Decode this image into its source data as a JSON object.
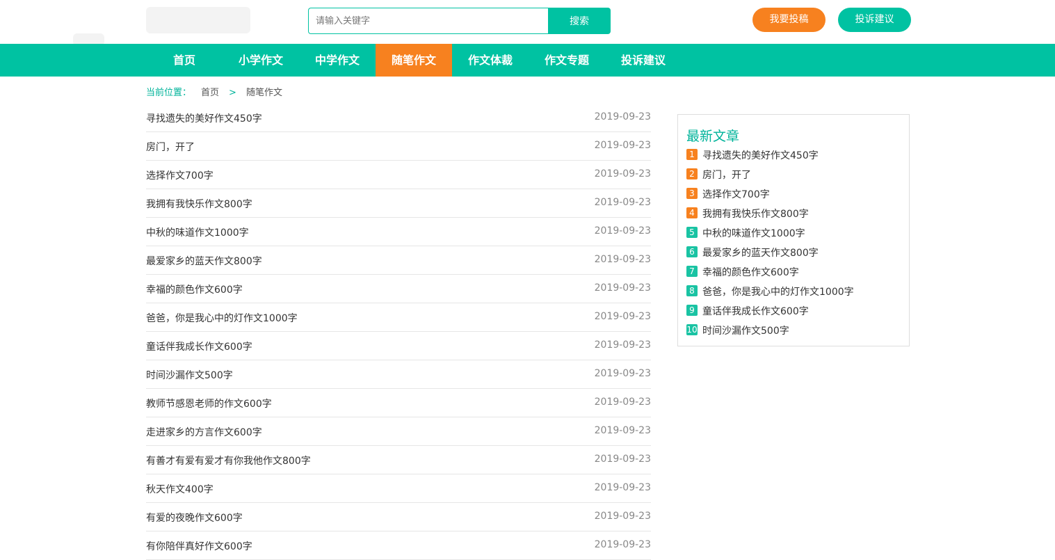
{
  "colors": {
    "teal": "#00c2a2",
    "orange": "#f7811f",
    "rank_top": "#f7811f",
    "rank_rest": "#19c3a3"
  },
  "search": {
    "placeholder": "请输入关键字",
    "value": "",
    "button_label": "搜索"
  },
  "header": {
    "submit_label": "我要投稿",
    "complaint_label": "投诉建议"
  },
  "nav": {
    "items": [
      {
        "label": "首页",
        "active": false
      },
      {
        "label": "小学作文",
        "active": false
      },
      {
        "label": "中学作文",
        "active": false
      },
      {
        "label": "随笔作文",
        "active": true
      },
      {
        "label": "作文体裁",
        "active": false
      },
      {
        "label": "作文专题",
        "active": false
      },
      {
        "label": "投诉建议",
        "active": false
      }
    ]
  },
  "breadcrumb": {
    "label": "当前位置：",
    "items": [
      "首页",
      "随笔作文"
    ],
    "separator": ">"
  },
  "articles": [
    {
      "title": "寻找遗失的美好作文450字",
      "date": "2019-09-23"
    },
    {
      "title": "房门，开了",
      "date": "2019-09-23"
    },
    {
      "title": "选择作文700字",
      "date": "2019-09-23"
    },
    {
      "title": "我拥有我快乐作文800字",
      "date": "2019-09-23"
    },
    {
      "title": "中秋的味道作文1000字",
      "date": "2019-09-23"
    },
    {
      "title": "最爱家乡的蓝天作文800字",
      "date": "2019-09-23"
    },
    {
      "title": "幸福的颜色作文600字",
      "date": "2019-09-23"
    },
    {
      "title": "爸爸，你是我心中的灯作文1000字",
      "date": "2019-09-23"
    },
    {
      "title": "童话伴我成长作文600字",
      "date": "2019-09-23"
    },
    {
      "title": "时间沙漏作文500字",
      "date": "2019-09-23"
    },
    {
      "title": "教师节感恩老师的作文600字",
      "date": "2019-09-23"
    },
    {
      "title": "走进家乡的方言作文600字",
      "date": "2019-09-23"
    },
    {
      "title": "有善才有爱有爱才有你我他作文800字",
      "date": "2019-09-23"
    },
    {
      "title": "秋天作文400字",
      "date": "2019-09-23"
    },
    {
      "title": "有爱的夜晚作文600字",
      "date": "2019-09-23"
    },
    {
      "title": "有你陪伴真好作文600字",
      "date": "2019-09-23"
    }
  ],
  "sidebar": {
    "title": "最新文章",
    "items": [
      {
        "rank": "1",
        "title": "寻找遗失的美好作文450字",
        "hot": true
      },
      {
        "rank": "2",
        "title": "房门，开了",
        "hot": true
      },
      {
        "rank": "3",
        "title": "选择作文700字",
        "hot": true
      },
      {
        "rank": "4",
        "title": "我拥有我快乐作文800字",
        "hot": true
      },
      {
        "rank": "5",
        "title": "中秋的味道作文1000字",
        "hot": false
      },
      {
        "rank": "6",
        "title": "最爱家乡的蓝天作文800字",
        "hot": false
      },
      {
        "rank": "7",
        "title": "幸福的颜色作文600字",
        "hot": false
      },
      {
        "rank": "8",
        "title": "爸爸，你是我心中的灯作文1000字",
        "hot": false
      },
      {
        "rank": "9",
        "title": "童话伴我成长作文600字",
        "hot": false
      },
      {
        "rank": "10",
        "title": "时间沙漏作文500字",
        "hot": false
      }
    ]
  }
}
